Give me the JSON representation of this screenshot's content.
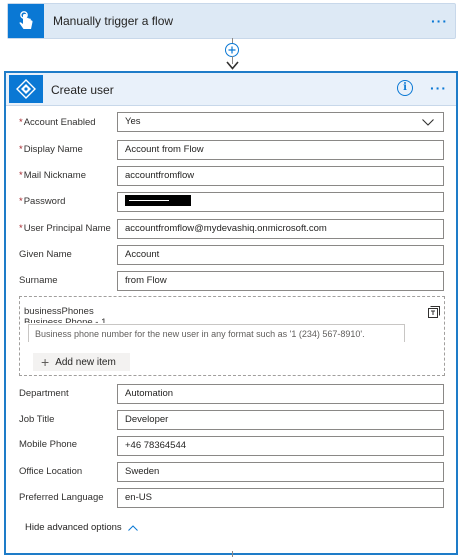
{
  "trigger": {
    "title": "Manually trigger a flow",
    "icon": "hand-tap-icon",
    "more": "···"
  },
  "action": {
    "title": "Create user",
    "icon": "azure-ad-icon",
    "info": "i",
    "more": "···"
  },
  "fields": {
    "account_enabled": {
      "label": "Account Enabled",
      "value": "Yes",
      "required": true
    },
    "display_name": {
      "label": "Display Name",
      "value": "Account from Flow",
      "required": true
    },
    "mail_nickname": {
      "label": "Mail Nickname",
      "value": "accountfromflow",
      "required": true
    },
    "password": {
      "label": "Password",
      "value": "",
      "required": true
    },
    "upn": {
      "label": "User Principal Name",
      "value": "accountfromflow@mydevashiq.onmicrosoft.com",
      "required": true
    },
    "given_name": {
      "label": "Given Name",
      "value": "Account"
    },
    "surname": {
      "label": "Surname",
      "value": "from Flow"
    },
    "department": {
      "label": "Department",
      "value": "Automation"
    },
    "job_title": {
      "label": "Job Title",
      "value": "Developer"
    },
    "mobile_phone": {
      "label": "Mobile Phone",
      "value": "+46 78364544"
    },
    "office_location": {
      "label": "Office Location",
      "value": "Sweden"
    },
    "preferred_language": {
      "label": "Preferred Language",
      "value": "en-US"
    }
  },
  "business_phones": {
    "title": "businessPhones",
    "item_label": "Business Phone - 1",
    "placeholder": "Business phone number for the new user in any format such as '1 (234) 567-8910'.",
    "add_label": "Add new item"
  },
  "footer": {
    "hide_advanced": "Hide advanced options"
  },
  "colors": {
    "accent": "#0a78d4",
    "required": "#a4262c",
    "border": "#1e7cc8"
  }
}
